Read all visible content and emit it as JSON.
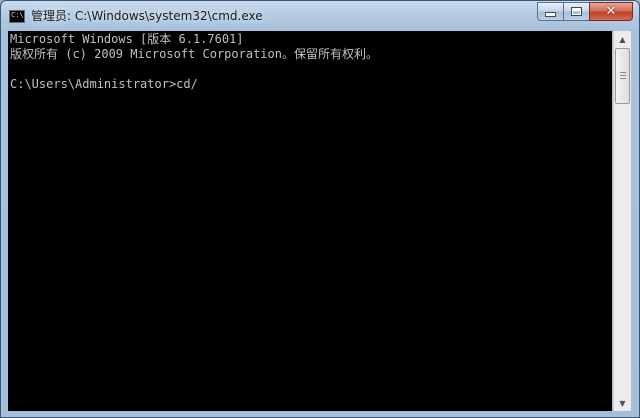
{
  "window": {
    "title": "管理员: C:\\Windows\\system32\\cmd.exe",
    "icon": "cmd-icon",
    "icon_text": "C:\\"
  },
  "caption_buttons": {
    "minimize": "minimize-icon",
    "maximize": "maximize-icon",
    "close": "close-icon",
    "close_glyph": "✕"
  },
  "console": {
    "lines": [
      "Microsoft Windows [版本 6.1.7601]",
      "版权所有 (c) 2009 Microsoft Corporation。保留所有权利。",
      "",
      "C:\\Users\\Administrator>cd/"
    ],
    "text_color": "#c0c0c0",
    "background_color": "#000000"
  },
  "scrollbar": {
    "up_arrow": "▲",
    "down_arrow": "▼"
  }
}
